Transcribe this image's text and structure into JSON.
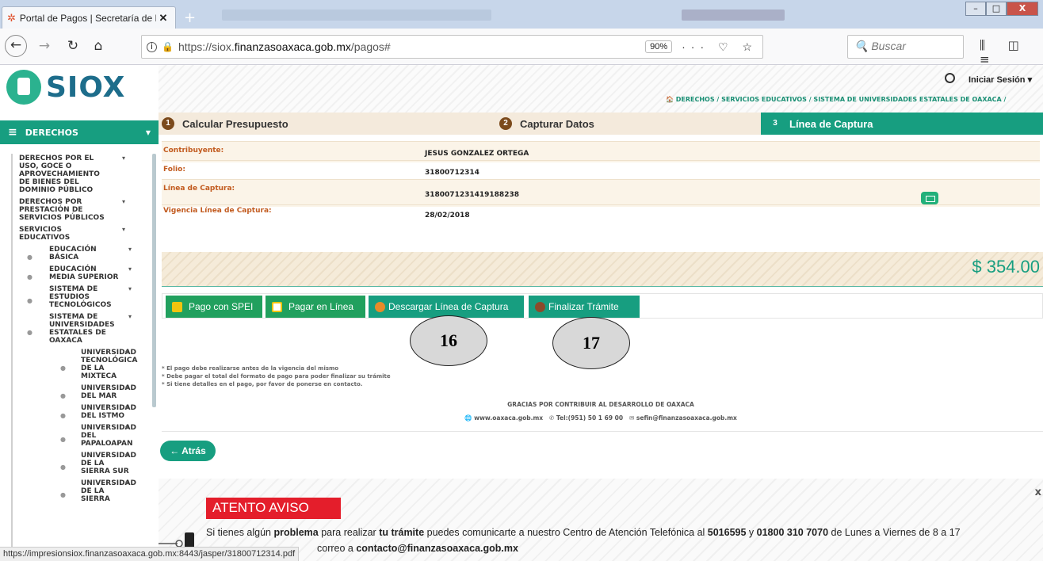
{
  "browser": {
    "tab_title": "Portal de Pagos | Secretaría de F",
    "tab_close": "✕",
    "new_tab": "+",
    "url_prefix": "https://siox.",
    "url_domain": "finanzasoaxaca.gob.mx",
    "url_path": "/pagos#",
    "zoom": "90%",
    "search_placeholder": "Buscar",
    "status_url": "https://impresionsiox.finanzasoaxaca.gob.mx:8443/jasper/31800712314.pdf"
  },
  "header": {
    "logo_text": "SIOX",
    "login_label": "Iniciar Sesión",
    "breadcrumb": "🏠 DERECHOS  /  SERVICIOS EDUCATIVOS  /  SISTEMA DE UNIVERSIDADES ESTATALES DE OAXACA  /"
  },
  "sidebar": {
    "header_label": "DERECHOS",
    "tree": [
      {
        "label": "DERECHOS POR EL USO, GOCE O APROVECHAMIENTO DE BIENES DEL DOMINIO PÚBLICO",
        "level": 0,
        "caret": true
      },
      {
        "label": "DERECHOS POR PRESTACIÓN DE SERVICIOS PÚBLICOS",
        "level": 0,
        "caret": true
      },
      {
        "label": "SERVICIOS EDUCATIVOS",
        "level": 0,
        "caret": true
      },
      {
        "label": "EDUCACIÓN BÁSICA",
        "level": 1,
        "caret": true
      },
      {
        "label": "EDUCACIÓN MEDIA SUPERIOR",
        "level": 1,
        "caret": true
      },
      {
        "label": "SISTEMA DE ESTUDIOS TECNOLÓGICOS",
        "level": 1,
        "caret": true
      },
      {
        "label": "SISTEMA DE UNIVERSIDADES ESTATALES DE OAXACA",
        "level": 1,
        "caret": true
      },
      {
        "label": "UNIVERSIDAD TECNOLÓGICA DE LA MIXTECA",
        "level": 2,
        "caret": true
      },
      {
        "label": "UNIVERSIDAD DEL MAR",
        "level": 2,
        "caret": true
      },
      {
        "label": "UNIVERSIDAD DEL ISTMO",
        "level": 2,
        "caret": true
      },
      {
        "label": "UNIVERSIDAD DEL PAPALOAPAN",
        "level": 2,
        "caret": true
      },
      {
        "label": "UNIVERSIDAD DE LA SIERRA SUR",
        "level": 2,
        "caret": true
      },
      {
        "label": "UNIVERSIDAD DE LA SIERRA",
        "level": 2,
        "caret": true
      }
    ]
  },
  "steps": [
    {
      "num": "1",
      "label": "Calcular Presupuesto"
    },
    {
      "num": "2",
      "label": "Capturar Datos"
    },
    {
      "num": "3",
      "label": "Línea de Captura"
    }
  ],
  "details": {
    "contribuyente_label": "Contribuyente:",
    "contribuyente_value": "JESUS GONZALEZ ORTEGA",
    "folio_label": "Folio:",
    "folio_value": "31800712314",
    "linea_label": "Línea de Captura:",
    "linea_value": "3180071231419188238",
    "vigencia_label": "Vigencia Línea de Captura:",
    "vigencia_value": "28/02/2018"
  },
  "total": "$ 354.00",
  "actions": {
    "spei": "Pago con SPEI",
    "online": "Pagar en Línea",
    "download": "Descargar Línea de Captura",
    "finish": "Finalizar Trámite"
  },
  "annotations": [
    "16",
    "17"
  ],
  "notes": [
    "* El pago debe realizarse antes de la vigencia del mismo",
    "* Debe pagar el total del formato de pago para poder finalizar su trámite",
    "* Si tiene detalles en el pago, por favor de ponerse en contacto."
  ],
  "footer": {
    "title": "GRACIAS POR CONTRIBUIR AL DESARROLLO DE OAXACA",
    "web": "www.oaxaca.gob.mx",
    "tel": "Tel:(951) 50 1 69 00",
    "email": "sefin@finanzasoaxaca.gob.mx"
  },
  "back_label": "← Atrás",
  "notice": {
    "title": "ATENTO AVISO",
    "text_a": "Si tienes algún ",
    "text_b": "problema",
    "text_c": " para realizar ",
    "text_d": "tu trámite",
    "text_e": " puedes comunicarte a nuestro Centro de Atención Telefónica al ",
    "text_f": "5016595",
    "text_g": " y ",
    "text_h": "01800 310 7070",
    "text_i": " de Lunes a Viernes de 8 a 17",
    "text_j": "correo a ",
    "text_k": "contacto@finanzasoaxaca.gob.mx",
    "close": "x"
  },
  "colors": {
    "teal": "#179e80",
    "green": "#21a05e",
    "alert_red": "#e41e2b",
    "label_orange": "#c25b1f"
  }
}
